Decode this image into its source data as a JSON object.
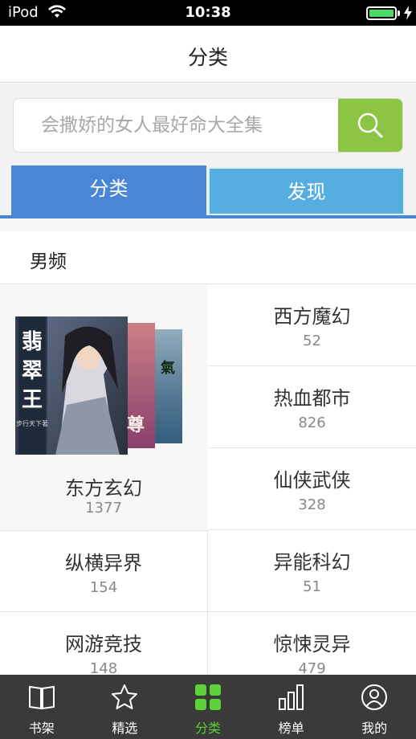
{
  "status_bar": {
    "carrier": "iPod",
    "time": "10:38",
    "battery_color": "#4cd964"
  },
  "navbar": {
    "title": "分类"
  },
  "search": {
    "placeholder": "会撒娇的女人最好命大全集",
    "button_icon": "search-icon",
    "button_color": "#8cc443"
  },
  "tabs": {
    "items": [
      {
        "label": "分类",
        "active": true
      },
      {
        "label": "发现",
        "active": false
      }
    ]
  },
  "section": {
    "title": "男频",
    "featured": {
      "name": "东方玄幻",
      "count": "1377",
      "cover_text": "翡翠王",
      "cover_author": "步行天下著"
    },
    "categories": [
      {
        "name": "西方魔幻",
        "count": "52"
      },
      {
        "name": "热血都市",
        "count": "826"
      },
      {
        "name": "仙侠武侠",
        "count": "328"
      },
      {
        "name": "纵横异界",
        "count": "154"
      },
      {
        "name": "异能科幻",
        "count": "51"
      },
      {
        "name": "网游竞技",
        "count": "148"
      },
      {
        "name": "惊悚灵异",
        "count": "479"
      }
    ]
  },
  "tab_bar": {
    "active_color": "#5bd235",
    "items": [
      {
        "label": "书架",
        "icon": "book-icon"
      },
      {
        "label": "精选",
        "icon": "star-icon"
      },
      {
        "label": "分类",
        "icon": "grid-icon",
        "active": true
      },
      {
        "label": "榜单",
        "icon": "bar-chart-icon"
      },
      {
        "label": "我的",
        "icon": "user-icon"
      }
    ]
  }
}
